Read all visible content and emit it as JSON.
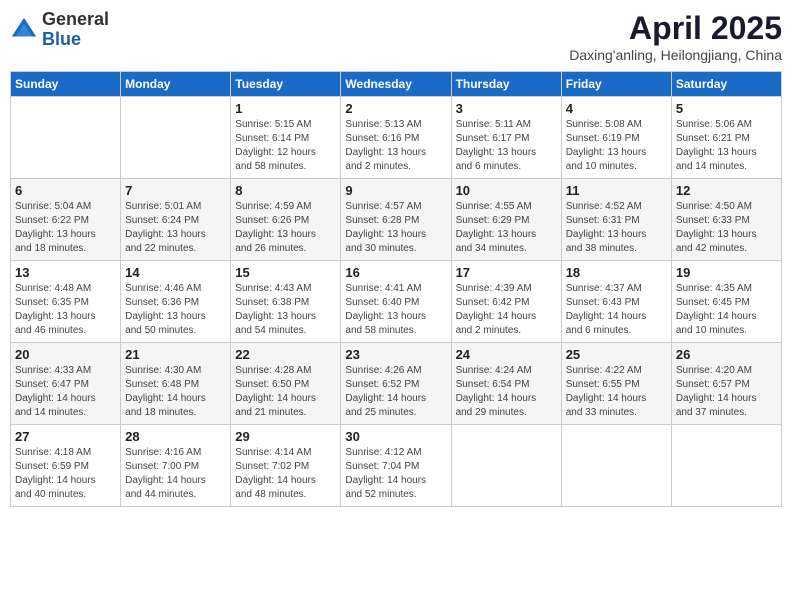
{
  "header": {
    "logo_general": "General",
    "logo_blue": "Blue",
    "month_year": "April 2025",
    "location": "Daxing'anling, Heilongjiang, China"
  },
  "days_of_week": [
    "Sunday",
    "Monday",
    "Tuesday",
    "Wednesday",
    "Thursday",
    "Friday",
    "Saturday"
  ],
  "weeks": [
    [
      {
        "day": "",
        "info": ""
      },
      {
        "day": "",
        "info": ""
      },
      {
        "day": "1",
        "info": "Sunrise: 5:15 AM\nSunset: 6:14 PM\nDaylight: 12 hours\nand 58 minutes."
      },
      {
        "day": "2",
        "info": "Sunrise: 5:13 AM\nSunset: 6:16 PM\nDaylight: 13 hours\nand 2 minutes."
      },
      {
        "day": "3",
        "info": "Sunrise: 5:11 AM\nSunset: 6:17 PM\nDaylight: 13 hours\nand 6 minutes."
      },
      {
        "day": "4",
        "info": "Sunrise: 5:08 AM\nSunset: 6:19 PM\nDaylight: 13 hours\nand 10 minutes."
      },
      {
        "day": "5",
        "info": "Sunrise: 5:06 AM\nSunset: 6:21 PM\nDaylight: 13 hours\nand 14 minutes."
      }
    ],
    [
      {
        "day": "6",
        "info": "Sunrise: 5:04 AM\nSunset: 6:22 PM\nDaylight: 13 hours\nand 18 minutes."
      },
      {
        "day": "7",
        "info": "Sunrise: 5:01 AM\nSunset: 6:24 PM\nDaylight: 13 hours\nand 22 minutes."
      },
      {
        "day": "8",
        "info": "Sunrise: 4:59 AM\nSunset: 6:26 PM\nDaylight: 13 hours\nand 26 minutes."
      },
      {
        "day": "9",
        "info": "Sunrise: 4:57 AM\nSunset: 6:28 PM\nDaylight: 13 hours\nand 30 minutes."
      },
      {
        "day": "10",
        "info": "Sunrise: 4:55 AM\nSunset: 6:29 PM\nDaylight: 13 hours\nand 34 minutes."
      },
      {
        "day": "11",
        "info": "Sunrise: 4:52 AM\nSunset: 6:31 PM\nDaylight: 13 hours\nand 38 minutes."
      },
      {
        "day": "12",
        "info": "Sunrise: 4:50 AM\nSunset: 6:33 PM\nDaylight: 13 hours\nand 42 minutes."
      }
    ],
    [
      {
        "day": "13",
        "info": "Sunrise: 4:48 AM\nSunset: 6:35 PM\nDaylight: 13 hours\nand 46 minutes."
      },
      {
        "day": "14",
        "info": "Sunrise: 4:46 AM\nSunset: 6:36 PM\nDaylight: 13 hours\nand 50 minutes."
      },
      {
        "day": "15",
        "info": "Sunrise: 4:43 AM\nSunset: 6:38 PM\nDaylight: 13 hours\nand 54 minutes."
      },
      {
        "day": "16",
        "info": "Sunrise: 4:41 AM\nSunset: 6:40 PM\nDaylight: 13 hours\nand 58 minutes."
      },
      {
        "day": "17",
        "info": "Sunrise: 4:39 AM\nSunset: 6:42 PM\nDaylight: 14 hours\nand 2 minutes."
      },
      {
        "day": "18",
        "info": "Sunrise: 4:37 AM\nSunset: 6:43 PM\nDaylight: 14 hours\nand 6 minutes."
      },
      {
        "day": "19",
        "info": "Sunrise: 4:35 AM\nSunset: 6:45 PM\nDaylight: 14 hours\nand 10 minutes."
      }
    ],
    [
      {
        "day": "20",
        "info": "Sunrise: 4:33 AM\nSunset: 6:47 PM\nDaylight: 14 hours\nand 14 minutes."
      },
      {
        "day": "21",
        "info": "Sunrise: 4:30 AM\nSunset: 6:48 PM\nDaylight: 14 hours\nand 18 minutes."
      },
      {
        "day": "22",
        "info": "Sunrise: 4:28 AM\nSunset: 6:50 PM\nDaylight: 14 hours\nand 21 minutes."
      },
      {
        "day": "23",
        "info": "Sunrise: 4:26 AM\nSunset: 6:52 PM\nDaylight: 14 hours\nand 25 minutes."
      },
      {
        "day": "24",
        "info": "Sunrise: 4:24 AM\nSunset: 6:54 PM\nDaylight: 14 hours\nand 29 minutes."
      },
      {
        "day": "25",
        "info": "Sunrise: 4:22 AM\nSunset: 6:55 PM\nDaylight: 14 hours\nand 33 minutes."
      },
      {
        "day": "26",
        "info": "Sunrise: 4:20 AM\nSunset: 6:57 PM\nDaylight: 14 hours\nand 37 minutes."
      }
    ],
    [
      {
        "day": "27",
        "info": "Sunrise: 4:18 AM\nSunset: 6:59 PM\nDaylight: 14 hours\nand 40 minutes."
      },
      {
        "day": "28",
        "info": "Sunrise: 4:16 AM\nSunset: 7:00 PM\nDaylight: 14 hours\nand 44 minutes."
      },
      {
        "day": "29",
        "info": "Sunrise: 4:14 AM\nSunset: 7:02 PM\nDaylight: 14 hours\nand 48 minutes."
      },
      {
        "day": "30",
        "info": "Sunrise: 4:12 AM\nSunset: 7:04 PM\nDaylight: 14 hours\nand 52 minutes."
      },
      {
        "day": "",
        "info": ""
      },
      {
        "day": "",
        "info": ""
      },
      {
        "day": "",
        "info": ""
      }
    ]
  ]
}
